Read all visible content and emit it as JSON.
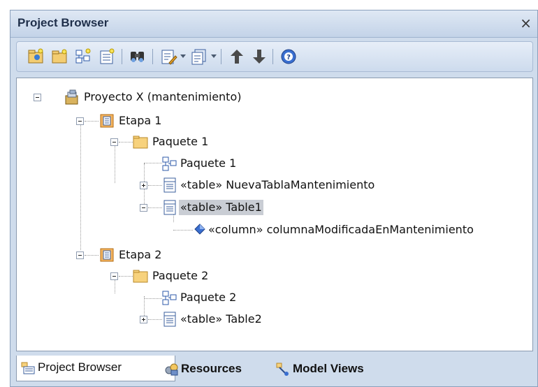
{
  "window": {
    "title": "Project Browser",
    "close_glyph": "×"
  },
  "toolbar": {
    "buttons": [
      {
        "icon": "new-model-package-icon"
      },
      {
        "icon": "new-package-icon"
      },
      {
        "icon": "new-diagram-icon"
      },
      {
        "icon": "new-element-icon"
      },
      {
        "icon": "find-binoculars-icon"
      },
      {
        "icon": "properties-icon"
      },
      {
        "icon": "package-control-icon"
      },
      {
        "icon": "move-up-arrow-icon"
      },
      {
        "icon": "move-down-arrow-icon"
      },
      {
        "icon": "help-icon"
      }
    ]
  },
  "tree": {
    "root": {
      "label": "Proyecto X (mantenimiento)",
      "icon": "model-root-icon",
      "expanded": true
    },
    "nodes": [
      {
        "label": "Etapa 1",
        "icon": "view-icon",
        "expanded": true
      },
      {
        "label": "Paquete 1",
        "icon": "folder-icon",
        "expanded": true
      },
      {
        "label": "Paquete 1",
        "icon": "diagram-icon"
      },
      {
        "label": "«table» NuevaTablaMantenimiento",
        "icon": "table-icon",
        "expanded": false
      },
      {
        "label": "«table» Table1",
        "icon": "table-icon",
        "expanded": true,
        "selected": true
      },
      {
        "label": "«column» columnaModificadaEnMantenimiento",
        "icon": "column-diamond-icon"
      },
      {
        "label": "Etapa 2",
        "icon": "view-icon",
        "expanded": true
      },
      {
        "label": "Paquete 2",
        "icon": "folder-icon",
        "expanded": true
      },
      {
        "label": "Paquete 2",
        "icon": "diagram-icon"
      },
      {
        "label": "«table» Table2",
        "icon": "table-icon",
        "expanded": false
      }
    ]
  },
  "tabs": [
    {
      "label": "Project Browser",
      "icon": "project-browser-icon",
      "active": true
    },
    {
      "label": "Resources",
      "icon": "resources-icon",
      "active": false
    },
    {
      "label": "Model Views",
      "icon": "model-views-icon",
      "active": false
    }
  ],
  "colors": {
    "panel_bg": "#cfdcec",
    "selection": "#c9cdd4",
    "folder": "#f2c77a",
    "view_orange": "#e8a24a",
    "table_blue": "#4a6fb5"
  }
}
